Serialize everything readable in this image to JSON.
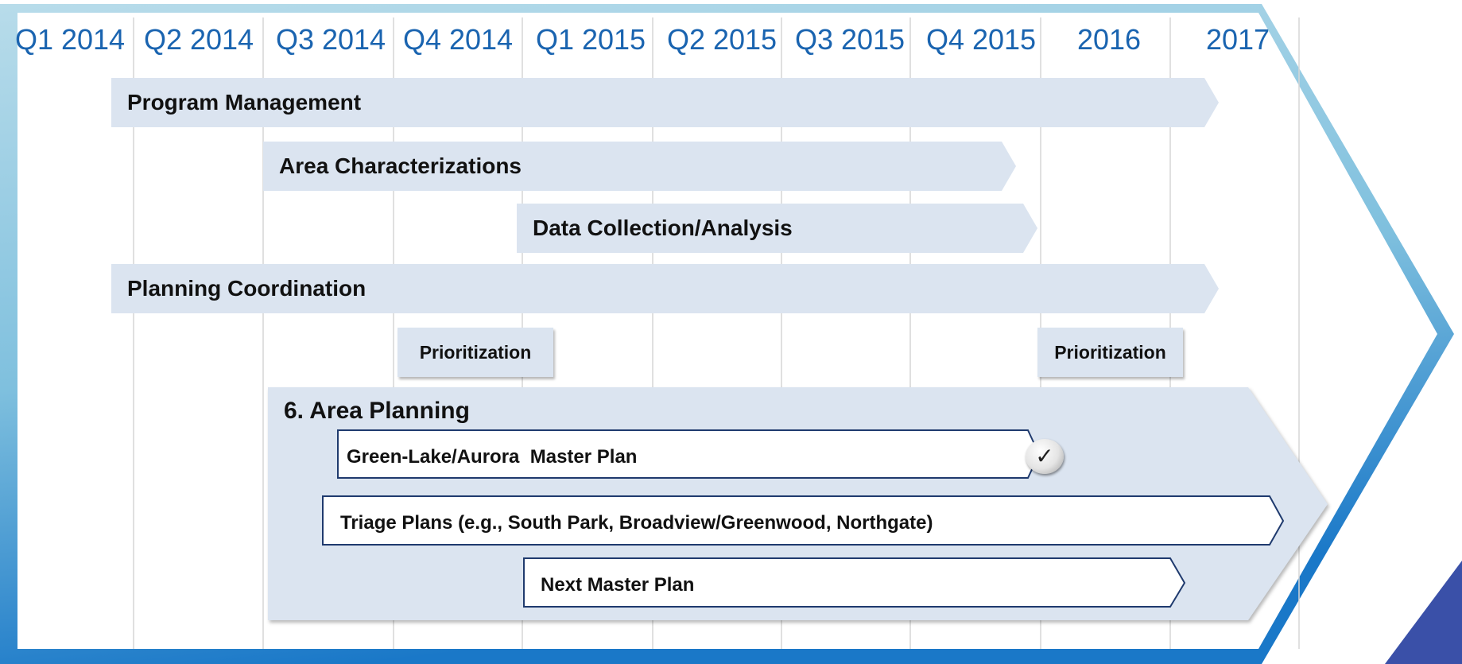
{
  "timeline": {
    "columns": [
      "Q1 2014",
      "Q2 2014",
      "Q3 2014",
      "Q4 2014",
      "Q1 2015",
      "Q2 2015",
      "Q3 2015",
      "Q4 2015",
      "2016",
      "2017"
    ]
  },
  "tracks": [
    {
      "name": "Program Management"
    },
    {
      "name": "Area Characterizations"
    },
    {
      "name": "Data Collection/Analysis"
    },
    {
      "name": "Planning Coordination"
    }
  ],
  "milestones": [
    {
      "name": "Prioritization"
    },
    {
      "name": "Prioritization"
    }
  ],
  "area_planning": {
    "title": "6. Area Planning",
    "items": [
      {
        "name": "Green-Lake/Aurora  Master Plan",
        "completed": true,
        "check_symbol": "✓"
      },
      {
        "name": "Triage Plans (e.g., South Park, Broadview/Greenwood, Northgate)"
      },
      {
        "name": "Next Master Plan"
      }
    ]
  },
  "colors": {
    "header_text": "#1a64b0",
    "bar_fill": "#dbe4f0",
    "frame_gradient": [
      "#aad4e6",
      "#1a78c8"
    ],
    "corner_accent": "#3a50a8",
    "sub_bar_border": "#1f3a6e"
  }
}
